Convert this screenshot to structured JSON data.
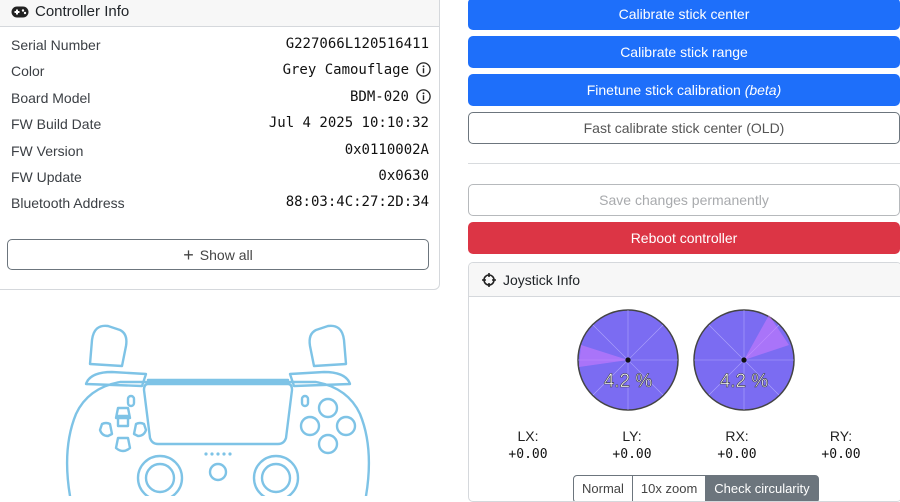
{
  "controller_info": {
    "title": "Controller Info",
    "rows": [
      {
        "label": "Serial Number",
        "value": "G227066L120516411",
        "info": false
      },
      {
        "label": "Color",
        "value": "Grey Camouflage",
        "info": true
      },
      {
        "label": "Board Model",
        "value": "BDM-020",
        "info": true
      },
      {
        "label": "FW Build Date",
        "value": "Jul 4 2025 10:10:32",
        "info": false
      },
      {
        "label": "FW Version",
        "value": "0x0110002A",
        "info": false
      },
      {
        "label": "FW Update",
        "value": "0x0630",
        "info": false
      },
      {
        "label": "Bluetooth Address",
        "value": "88:03:4C:27:2D:34",
        "info": false
      }
    ],
    "show_all_label": "Show all"
  },
  "calibration": {
    "calibrate_center": "Calibrate stick center",
    "calibrate_range": "Calibrate stick range",
    "finetune": "Finetune stick calibration",
    "finetune_suffix": "(beta)",
    "fast_calibrate": "Fast calibrate stick center (OLD)"
  },
  "actions": {
    "save": "Save changes permanently",
    "reboot": "Reboot controller"
  },
  "joystick": {
    "title": "Joystick Info",
    "left_error": "4.2 %",
    "right_error": "4.2 %",
    "axes": [
      {
        "label": "LX:",
        "value": "+0.00"
      },
      {
        "label": "LY:",
        "value": "+0.00"
      },
      {
        "label": "RX:",
        "value": "+0.00"
      },
      {
        "label": "RY:",
        "value": "+0.00"
      }
    ],
    "modes": [
      "Normal",
      "10x zoom",
      "Check circularity"
    ],
    "active_mode": "Check circularity"
  },
  "colors": {
    "primary": "#1e6ffa",
    "danger": "#dc3545",
    "circle_fill": "#7b6cf2",
    "gamepad_line": "#7ec3e6"
  }
}
